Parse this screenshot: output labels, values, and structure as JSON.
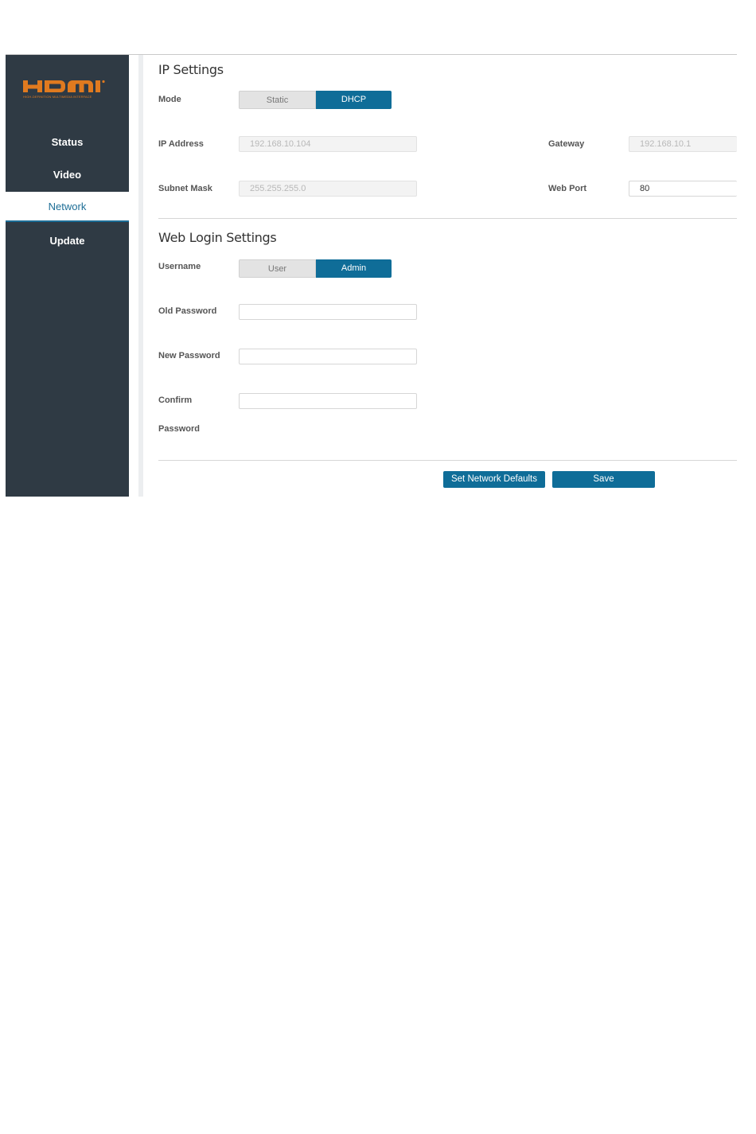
{
  "sidebar": {
    "logo_text": "HDMI",
    "logo_subtitle": "HIGH-DEFINITION MULTIMEDIA INTERFACE",
    "items": [
      {
        "label": "Status"
      },
      {
        "label": "Video"
      },
      {
        "label": "Network",
        "active": true
      },
      {
        "label": "Update"
      }
    ]
  },
  "ip_settings": {
    "title": "IP Settings",
    "mode_label": "Mode",
    "mode_options": [
      "Static",
      "DHCP"
    ],
    "mode_selected": "DHCP",
    "ip_address_label": "IP Address",
    "ip_address_value": "192.168.10.104",
    "subnet_mask_label": "Subnet Mask",
    "subnet_mask_value": "255.255.255.0",
    "gateway_label": "Gateway",
    "gateway_value": "192.168.10.1",
    "web_port_label": "Web Port",
    "web_port_value": "80"
  },
  "web_login": {
    "title": "Web Login Settings",
    "username_label": "Username",
    "username_options": [
      "User",
      "Admin"
    ],
    "username_selected": "Admin",
    "old_password_label": "Old Password",
    "new_password_label": "New Password",
    "confirm_label_line1": "Confirm",
    "confirm_label_line2": "Password"
  },
  "actions": {
    "set_defaults_label": "Set Network Defaults",
    "save_label": "Save"
  },
  "colors": {
    "sidebar_bg": "#2f3a44",
    "accent": "#0f6d98",
    "logo_orange": "#e07a1f"
  }
}
